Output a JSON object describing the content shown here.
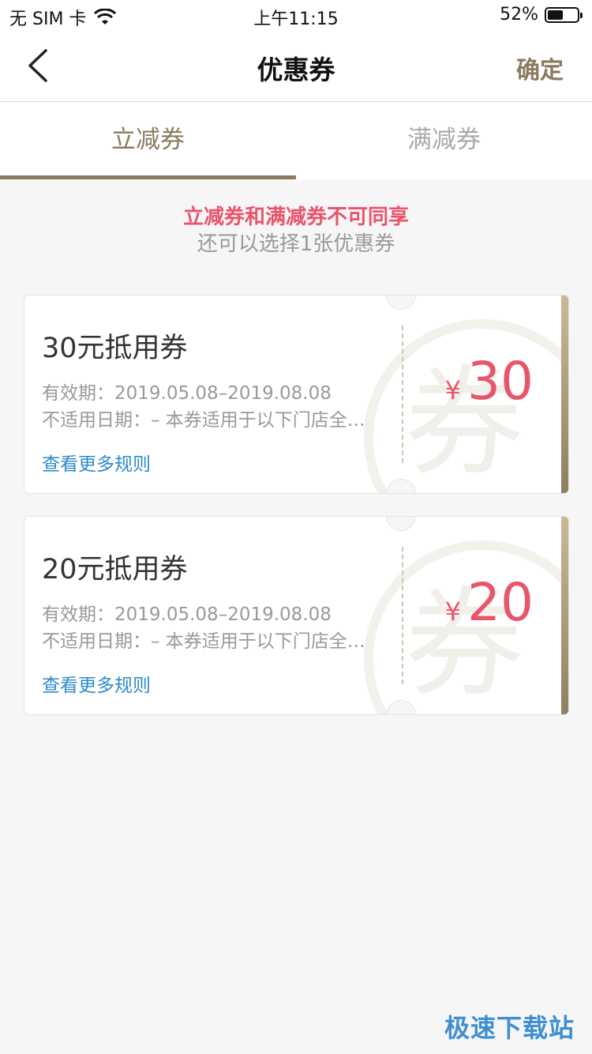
{
  "status_bar": {
    "carrier": "无 SIM 卡",
    "time": "上午11:15",
    "battery": "52%",
    "battery_level": 0.52
  },
  "nav": {
    "title": "优惠券",
    "confirm_label": "确定"
  },
  "tabs": [
    {
      "label": "立减券",
      "active": true
    },
    {
      "label": "满减券",
      "active": false
    }
  ],
  "notice": {
    "warning": "立减券和满减券不可同享",
    "hint": "还可以选择1张优惠券"
  },
  "coupons": [
    {
      "name": "30元抵用券",
      "validity": "有效期：2019.05.08–2019.08.08",
      "excluded": "不适用日期：– 本券适用于以下门店全…",
      "rules_link": "查看更多规则",
      "currency": "¥",
      "amount": "30",
      "watermark": "券"
    },
    {
      "name": "20元抵用券",
      "validity": "有效期：2019.05.08–2019.08.08",
      "excluded": "不适用日期：– 本券适用于以下门店全…",
      "rules_link": "查看更多规则",
      "currency": "¥",
      "amount": "20",
      "watermark": "券"
    }
  ],
  "watermark_brand": "极速下载站",
  "colors": {
    "accent": "#8b7a5e",
    "price": "#e9556b",
    "link": "#2d8ac9"
  }
}
